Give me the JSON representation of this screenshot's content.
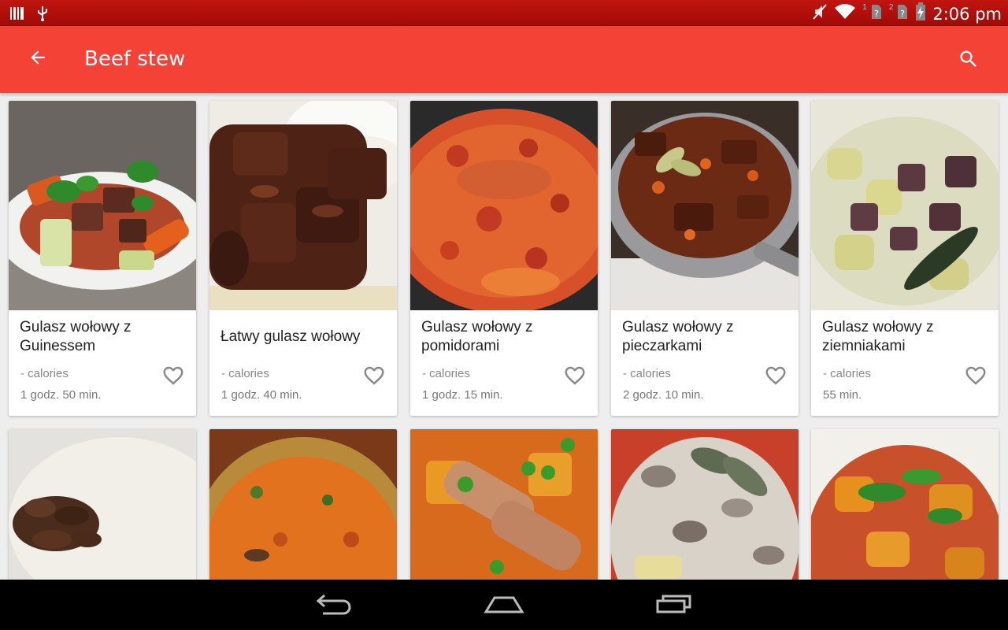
{
  "status_bar": {
    "time": "2:06 pm",
    "sim1": "1",
    "sim2": "2",
    "icons": [
      "barcode-icon",
      "usb-icon",
      "mute-icon",
      "wifi-icon",
      "sim1-icon",
      "sim2-icon",
      "battery-charging-icon"
    ]
  },
  "app_bar": {
    "title": "Beef stew",
    "back_icon": "arrow-back-icon",
    "search_icon": "search-icon",
    "color": "#f44336"
  },
  "recipes": [
    {
      "name": "Gulasz wołowy z Guinessem",
      "calories": "- calories",
      "time": "1 godz. 50 min."
    },
    {
      "name": "Łatwy gulasz wołowy",
      "calories": "- calories",
      "time": "1 godz. 40 min."
    },
    {
      "name": "Gulasz wołowy z pomidorami",
      "calories": "- calories",
      "time": "1 godz. 15 min."
    },
    {
      "name": "Gulasz wołowy z pieczarkami",
      "calories": "- calories",
      "time": "2 godz. 10 min."
    },
    {
      "name": "Gulasz wołowy z ziemniakami",
      "calories": "- calories",
      "time": "55 min."
    }
  ],
  "colors": {
    "status_bar": "#b00f0a",
    "accent": "#f44336",
    "heart": "#8a8a8a"
  }
}
